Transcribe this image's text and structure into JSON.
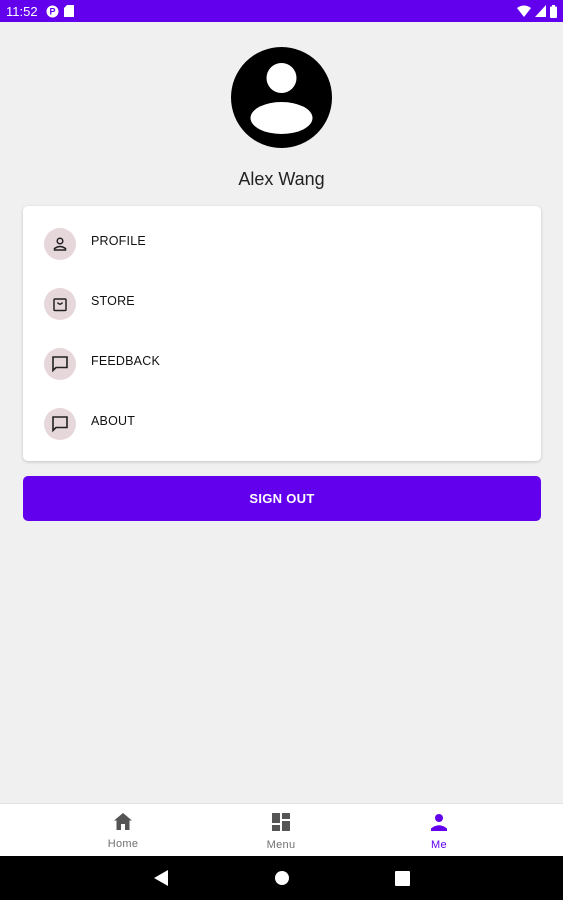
{
  "status_bar": {
    "time": "11:52",
    "icons_left": [
      "notification-p-icon",
      "sd-card-icon"
    ],
    "icons_right": [
      "wifi-icon",
      "cell-signal-icon",
      "battery-icon"
    ],
    "background": "#6200ee"
  },
  "profile": {
    "name": "Alex Wang",
    "avatar_icon": "account-circle-icon"
  },
  "menu": {
    "items": [
      {
        "label": "PROFILE",
        "icon": "person-icon"
      },
      {
        "label": "STORE",
        "icon": "shopping-bag-icon"
      },
      {
        "label": "FEEDBACK",
        "icon": "chat-bubble-icon"
      },
      {
        "label": "ABOUT",
        "icon": "chat-bubble-icon"
      }
    ]
  },
  "signout": {
    "label": "SIGN OUT"
  },
  "bottom_nav": {
    "items": [
      {
        "label": "Home",
        "icon": "home-icon",
        "active": false
      },
      {
        "label": "Menu",
        "icon": "dashboard-icon",
        "active": false
      },
      {
        "label": "Me",
        "icon": "person-icon",
        "active": true
      }
    ]
  },
  "colors": {
    "primary": "#6200ee",
    "icon_chip": "#e6d7db",
    "background": "#f0f0f0"
  }
}
